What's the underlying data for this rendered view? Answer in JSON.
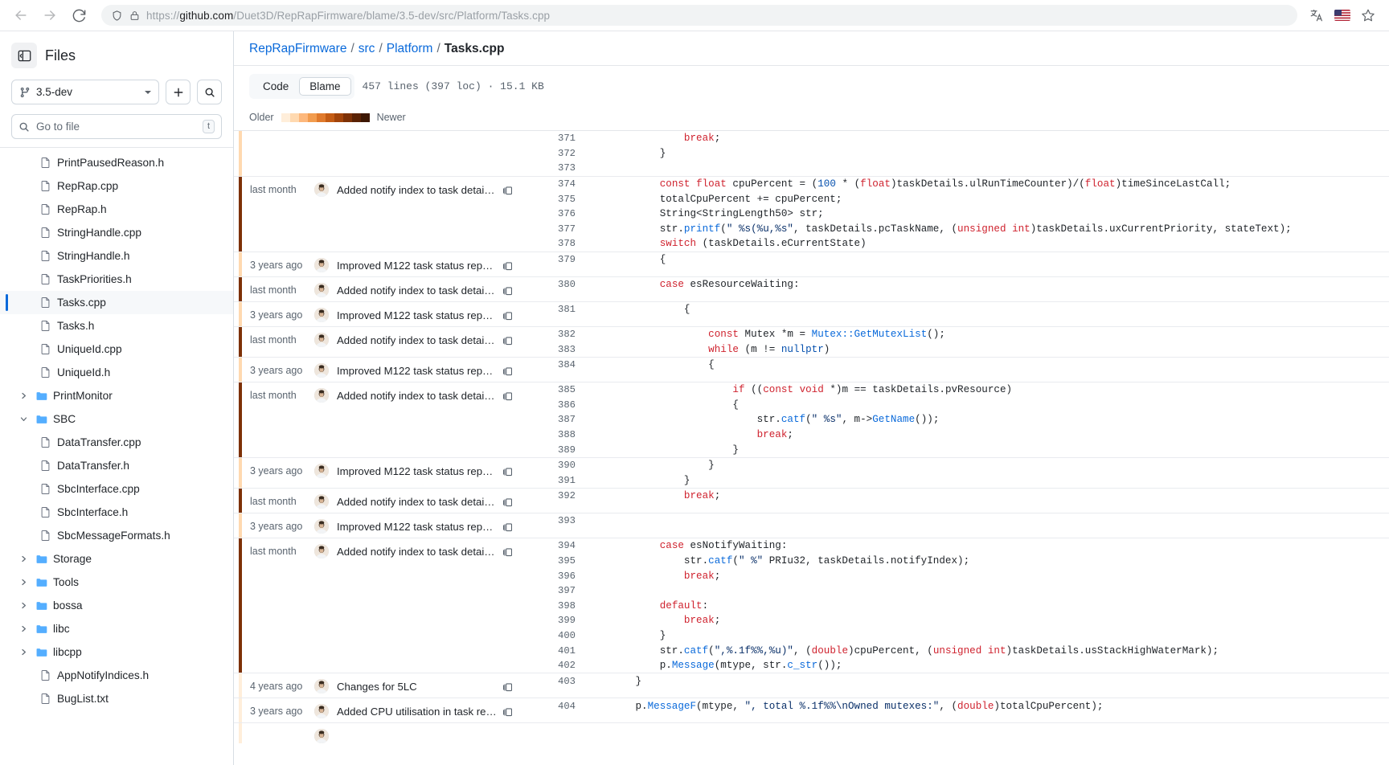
{
  "browser": {
    "back_label": "Back",
    "forward_label": "Forward",
    "reload_label": "Reload",
    "url_prefix": "https://",
    "url_host": "github.com",
    "url_path": "/Duet3D/RepRapFirmware/blame/3.5-dev/src/Platform/Tasks.cpp",
    "url_full": "https://github.com/Duet3D/RepRapFirmware/blame/3.5-dev/src/Platform/Tasks.cpp",
    "translate_label": "Translate this page",
    "bookmark_label": "Bookmark this page",
    "flag_label": "US"
  },
  "sidebar": {
    "title": "Files",
    "toggle_label": "Hide file tree",
    "branch": "3.5-dev",
    "add_label": "+",
    "search_label": "Search this repository",
    "gotofile_placeholder": "Go to file",
    "gotofile_key": "t",
    "items": [
      {
        "label": "PrintPausedReason.h",
        "type": "file",
        "depth": 2,
        "selected": false,
        "expanded": null
      },
      {
        "label": "RepRap.cpp",
        "type": "file",
        "depth": 2,
        "selected": false,
        "expanded": null
      },
      {
        "label": "RepRap.h",
        "type": "file",
        "depth": 2,
        "selected": false,
        "expanded": null
      },
      {
        "label": "StringHandle.cpp",
        "type": "file",
        "depth": 2,
        "selected": false,
        "expanded": null
      },
      {
        "label": "StringHandle.h",
        "type": "file",
        "depth": 2,
        "selected": false,
        "expanded": null
      },
      {
        "label": "TaskPriorities.h",
        "type": "file",
        "depth": 2,
        "selected": false,
        "expanded": null
      },
      {
        "label": "Tasks.cpp",
        "type": "file",
        "depth": 2,
        "selected": true,
        "expanded": null
      },
      {
        "label": "Tasks.h",
        "type": "file",
        "depth": 2,
        "selected": false,
        "expanded": null
      },
      {
        "label": "UniqueId.cpp",
        "type": "file",
        "depth": 2,
        "selected": false,
        "expanded": null
      },
      {
        "label": "UniqueId.h",
        "type": "file",
        "depth": 2,
        "selected": false,
        "expanded": null
      },
      {
        "label": "PrintMonitor",
        "type": "folder",
        "depth": 1,
        "selected": false,
        "expanded": false
      },
      {
        "label": "SBC",
        "type": "folder",
        "depth": 1,
        "selected": false,
        "expanded": true
      },
      {
        "label": "DataTransfer.cpp",
        "type": "file",
        "depth": 2,
        "selected": false,
        "expanded": null
      },
      {
        "label": "DataTransfer.h",
        "type": "file",
        "depth": 2,
        "selected": false,
        "expanded": null
      },
      {
        "label": "SbcInterface.cpp",
        "type": "file",
        "depth": 2,
        "selected": false,
        "expanded": null
      },
      {
        "label": "SbcInterface.h",
        "type": "file",
        "depth": 2,
        "selected": false,
        "expanded": null
      },
      {
        "label": "SbcMessageFormats.h",
        "type": "file",
        "depth": 2,
        "selected": false,
        "expanded": null
      },
      {
        "label": "Storage",
        "type": "folder",
        "depth": 1,
        "selected": false,
        "expanded": false
      },
      {
        "label": "Tools",
        "type": "folder",
        "depth": 1,
        "selected": false,
        "expanded": false
      },
      {
        "label": "bossa",
        "type": "folder",
        "depth": 1,
        "selected": false,
        "expanded": false
      },
      {
        "label": "libc",
        "type": "folder",
        "depth": 1,
        "selected": false,
        "expanded": false
      },
      {
        "label": "libcpp",
        "type": "folder",
        "depth": 1,
        "selected": false,
        "expanded": false
      },
      {
        "label": "AppNotifyIndices.h",
        "type": "file",
        "depth": 2,
        "selected": false,
        "expanded": null
      },
      {
        "label": "BugList.txt",
        "type": "file",
        "depth": 2,
        "selected": false,
        "expanded": null
      }
    ]
  },
  "breadcrumb": {
    "repo": "RepRapFirmware",
    "sep": "/",
    "parts": [
      "src",
      "Platform"
    ],
    "current": "Tasks.cpp"
  },
  "toolbar": {
    "tab_code": "Code",
    "tab_blame": "Blame",
    "active_tab": "Blame",
    "file_meta": "457 lines (397 loc) · 15.1 KB"
  },
  "legend": {
    "older": "Older",
    "newer": "Newer",
    "swatches": [
      "#ffeeda",
      "#ffd9b0",
      "#fdb87c",
      "#f29c4e",
      "#e07a2c",
      "#c45c14",
      "#a2440a",
      "#7d3106",
      "#5a2204",
      "#3d1703"
    ]
  },
  "blame": {
    "groups": [
      {
        "age": "",
        "author_shown": false,
        "message": "",
        "age_color": "#ffd9b0",
        "lines": [
          {
            "num": "371",
            "html": "                <span class=\"k\">break</span>;"
          },
          {
            "num": "372",
            "html": "            }"
          },
          {
            "num": "373",
            "html": ""
          }
        ]
      },
      {
        "age": "last month",
        "author_shown": true,
        "message": "Added notify index to task detail…",
        "age_color": "#7d3106",
        "lines": [
          {
            "num": "374",
            "html": "            <span class=\"k\">const</span> <span class=\"k\">float</span> cpuPercent = (<span class=\"n\">100</span> * (<span class=\"k\">float</span>)taskDetails.ulRunTimeCounter)/(<span class=\"k\">float</span>)timeSinceLastCall;"
          },
          {
            "num": "375",
            "html": "            totalCpuPercent += cpuPercent;"
          },
          {
            "num": "376",
            "html": "            String&lt;StringLength50&gt; str;"
          },
          {
            "num": "377",
            "html": "            str.<span class=\"f\">printf</span>(<span class=\"s\">\" %s(%u,%s\"</span>, taskDetails.pcTaskName, (<span class=\"k\">unsigned int</span>)taskDetails.uxCurrentPriority, stateText);"
          },
          {
            "num": "378",
            "html": "            <span class=\"k\">switch</span> (taskDetails.eCurrentState)"
          }
        ]
      },
      {
        "age": "3 years ago",
        "author_shown": true,
        "message": "Improved M122 task status repo…",
        "age_color": "#ffd9b0",
        "lines": [
          {
            "num": "379",
            "html": "            {"
          }
        ]
      },
      {
        "age": "last month",
        "author_shown": true,
        "message": "Added notify index to task detail…",
        "age_color": "#7d3106",
        "lines": [
          {
            "num": "380",
            "html": "            <span class=\"k\">case</span> esResourceWaiting:"
          }
        ]
      },
      {
        "age": "3 years ago",
        "author_shown": true,
        "message": "Improved M122 task status repo…",
        "age_color": "#ffd9b0",
        "lines": [
          {
            "num": "381",
            "html": "                {"
          }
        ]
      },
      {
        "age": "last month",
        "author_shown": true,
        "message": "Added notify index to task detail…",
        "age_color": "#7d3106",
        "lines": [
          {
            "num": "382",
            "html": "                    <span class=\"k\">const</span> Mutex *m = <span class=\"f\">Mutex::GetMutexList</span>();"
          },
          {
            "num": "383",
            "html": "                    <span class=\"k\">while</span> (m != <span class=\"n\">nullptr</span>)"
          }
        ]
      },
      {
        "age": "3 years ago",
        "author_shown": true,
        "message": "Improved M122 task status repo…",
        "age_color": "#ffd9b0",
        "lines": [
          {
            "num": "384",
            "html": "                    {"
          }
        ]
      },
      {
        "age": "last month",
        "author_shown": true,
        "message": "Added notify index to task detail…",
        "age_color": "#7d3106",
        "lines": [
          {
            "num": "385",
            "html": "                        <span class=\"k\">if</span> ((<span class=\"k\">const</span> <span class=\"k\">void</span> *)m == taskDetails.pvResource)"
          },
          {
            "num": "386",
            "html": "                        {"
          },
          {
            "num": "387",
            "html": "                            str.<span class=\"f\">catf</span>(<span class=\"s\">\" %s\"</span>, m-&gt;<span class=\"f\">GetName</span>());"
          },
          {
            "num": "388",
            "html": "                            <span class=\"k\">break</span>;"
          },
          {
            "num": "389",
            "html": "                        }"
          }
        ]
      },
      {
        "age": "3 years ago",
        "author_shown": true,
        "message": "Improved M122 task status repo…",
        "age_color": "#ffd9b0",
        "lines": [
          {
            "num": "390",
            "html": "                    }"
          },
          {
            "num": "391",
            "html": "                }"
          }
        ]
      },
      {
        "age": "last month",
        "author_shown": true,
        "message": "Added notify index to task detail…",
        "age_color": "#7d3106",
        "lines": [
          {
            "num": "392",
            "html": "                <span class=\"k\">break</span>;"
          }
        ]
      },
      {
        "age": "3 years ago",
        "author_shown": true,
        "message": "Improved M122 task status repo…",
        "age_color": "#ffd9b0",
        "lines": [
          {
            "num": "393",
            "html": ""
          }
        ]
      },
      {
        "age": "last month",
        "author_shown": true,
        "message": "Added notify index to task detail…",
        "age_color": "#7d3106",
        "lines": [
          {
            "num": "394",
            "html": "            <span class=\"k\">case</span> esNotifyWaiting:"
          },
          {
            "num": "395",
            "html": "                str.<span class=\"f\">catf</span>(<span class=\"s\">\" %\"</span> PRIu32, taskDetails.notifyIndex);"
          },
          {
            "num": "396",
            "html": "                <span class=\"k\">break</span>;"
          },
          {
            "num": "397",
            "html": ""
          },
          {
            "num": "398",
            "html": "            <span class=\"k\">default</span>:"
          },
          {
            "num": "399",
            "html": "                <span class=\"k\">break</span>;"
          },
          {
            "num": "400",
            "html": "            }"
          },
          {
            "num": "401",
            "html": "            str.<span class=\"f\">catf</span>(<span class=\"s\">\",%.1f%%,%u)\"</span>, (<span class=\"k\">double</span>)cpuPercent, (<span class=\"k\">unsigned int</span>)taskDetails.usStackHighWaterMark);"
          },
          {
            "num": "402",
            "html": "            p.<span class=\"f\">Message</span>(mtype, str.<span class=\"f\">c_str</span>());"
          }
        ]
      },
      {
        "age": "4 years ago",
        "author_shown": true,
        "message": "Changes for 5LC",
        "age_color": "#ffeeda",
        "lines": [
          {
            "num": "403",
            "html": "        }"
          }
        ]
      },
      {
        "age": "3 years ago",
        "author_shown": true,
        "message": "Added CPU utilisation in task re…",
        "age_color": "#ffeeda",
        "lines": [
          {
            "num": "404",
            "html": "        p.<span class=\"f\">MessageF</span>(mtype, <span class=\"s\">\", total %.1f%%\\nOwned mutexes:\"</span>, (<span class=\"k\">double</span>)totalCpuPercent);"
          }
        ]
      },
      {
        "age": "",
        "author_shown": true,
        "message": "",
        "age_color": "#ffeeda",
        "lines": [
          {
            "num": "",
            "html": ""
          }
        ]
      }
    ]
  }
}
